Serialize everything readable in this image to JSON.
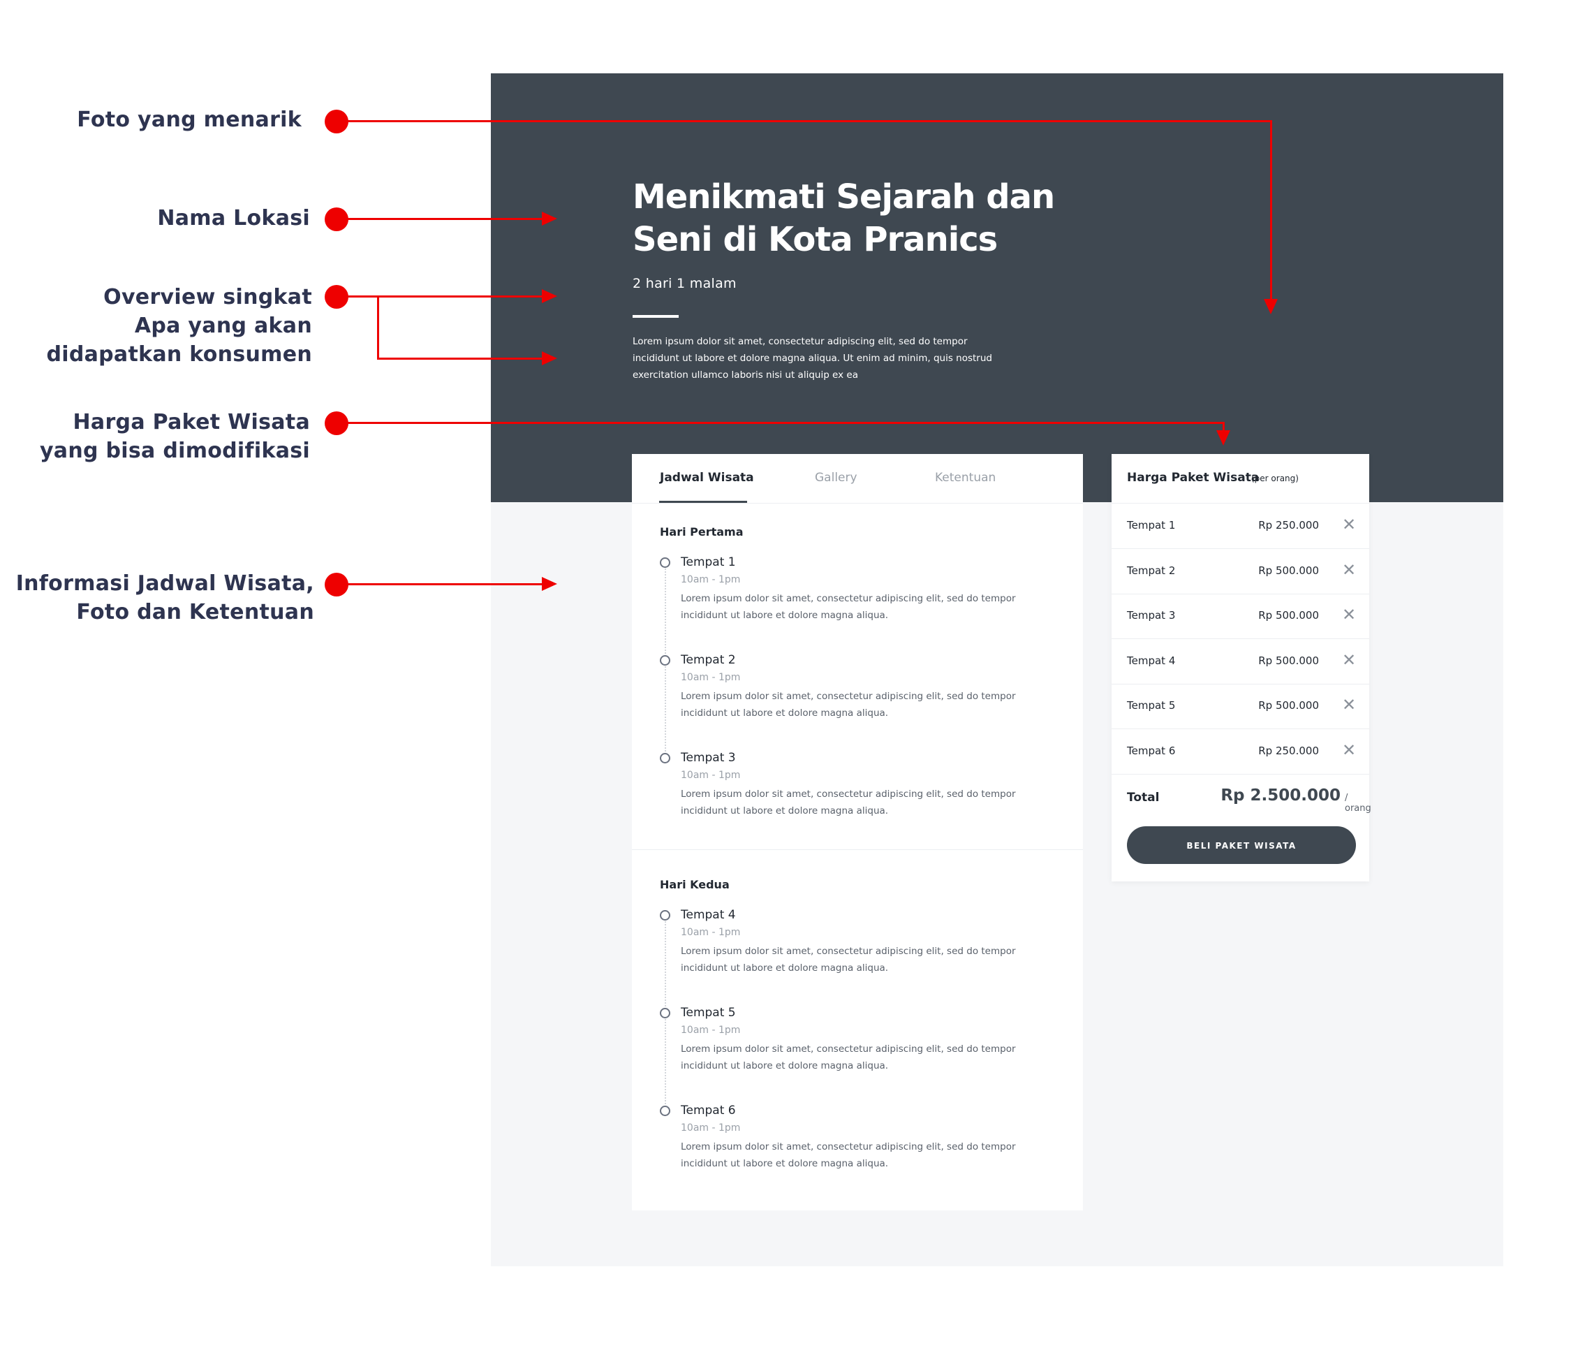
{
  "annotations": {
    "photo": [
      "Foto yang menarik"
    ],
    "location": [
      "Nama Lokasi"
    ],
    "overview": [
      "Overview singkat",
      "Apa yang akan",
      "didapatkan konsumen"
    ],
    "price": [
      "Harga Paket Wisata",
      "yang bisa dimodifikasi"
    ],
    "schedule": [
      "Informasi Jadwal Wisata,",
      "Foto dan Ketentuan"
    ],
    "marker_color": "#ee0000"
  },
  "hero": {
    "title_line1": "Menikmati Sejarah dan",
    "title_line2": "Seni di Kota Pranics",
    "duration": "2 hari 1 malam",
    "description": "Lorem ipsum dolor sit amet, consectetur adipiscing elit, sed do tempor incididunt ut labore et dolore magna aliqua. Ut enim ad minim, quis nostrud exercitation ullamco laboris nisi ut aliquip ex ea",
    "background_color": "#3f4851"
  },
  "tabs": [
    {
      "label": "Jadwal Wisata",
      "active": true
    },
    {
      "label": "Gallery",
      "active": false
    },
    {
      "label": "Ketentuan",
      "active": false
    }
  ],
  "schedule": {
    "days": [
      {
        "title": "Hari Pertama",
        "places": [
          {
            "name": "Tempat 1",
            "time": "10am - 1pm",
            "desc": "Lorem ipsum dolor sit amet, consectetur adipiscing elit, sed do tempor incididunt ut labore et dolore magna aliqua."
          },
          {
            "name": "Tempat 2",
            "time": "10am - 1pm",
            "desc": "Lorem ipsum dolor sit amet, consectetur adipiscing elit, sed do tempor incididunt ut labore et dolore magna aliqua."
          },
          {
            "name": "Tempat 3",
            "time": "10am - 1pm",
            "desc": "Lorem ipsum dolor sit amet, consectetur adipiscing elit, sed do tempor incididunt ut labore et dolore magna aliqua."
          }
        ]
      },
      {
        "title": "Hari Kedua",
        "places": [
          {
            "name": "Tempat 4",
            "time": "10am - 1pm",
            "desc": "Lorem ipsum dolor sit amet, consectetur adipiscing elit, sed do tempor incididunt ut labore et dolore magna aliqua."
          },
          {
            "name": "Tempat 5",
            "time": "10am - 1pm",
            "desc": "Lorem ipsum dolor sit amet, consectetur adipiscing elit, sed do tempor incididunt ut labore et dolore magna aliqua."
          },
          {
            "name": "Tempat 6",
            "time": "10am - 1pm",
            "desc": "Lorem ipsum dolor sit amet, consectetur adipiscing elit, sed do tempor incididunt ut labore et dolore magna aliqua."
          }
        ]
      }
    ]
  },
  "pricing": {
    "title": "Harga Paket Wisata",
    "unit": "(per orang)",
    "items": [
      {
        "name": "Tempat 1",
        "price": "Rp 250.000",
        "remove_icon": "close-icon"
      },
      {
        "name": "Tempat 2",
        "price": "Rp 500.000",
        "remove_icon": "close-icon"
      },
      {
        "name": "Tempat 3",
        "price": "Rp 500.000",
        "remove_icon": "close-icon"
      },
      {
        "name": "Tempat 4",
        "price": "Rp 500.000",
        "remove_icon": "close-icon"
      },
      {
        "name": "Tempat 5",
        "price": "Rp 500.000",
        "remove_icon": "close-icon"
      },
      {
        "name": "Tempat 6",
        "price": "Rp 250.000",
        "remove_icon": "close-icon"
      }
    ],
    "total_label": "Total",
    "total_value": "Rp 2.500.000",
    "total_unit": "/ orang",
    "buy_label": "BELI PAKET WISATA",
    "accent_color": "#3f4851"
  }
}
